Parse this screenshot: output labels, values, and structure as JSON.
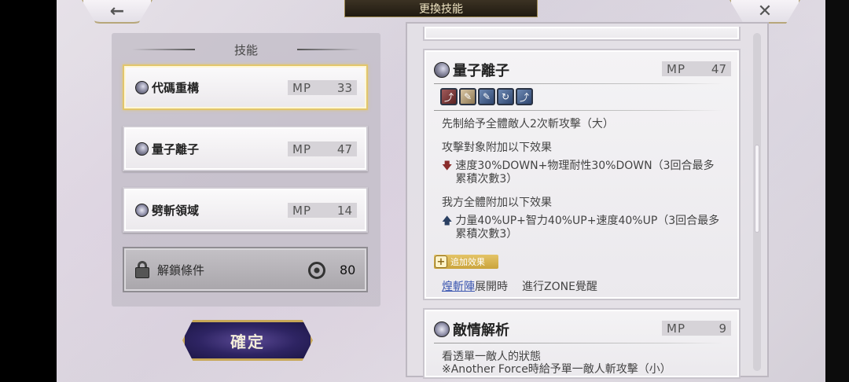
{
  "header": {
    "title": "更換技能",
    "back_icon": "←",
    "close_icon": "✕"
  },
  "left_panel": {
    "title": "技能",
    "skills": [
      {
        "name": "代碼重構",
        "mp_label": "MP",
        "mp": "33",
        "icon": "quantum-icon",
        "selected": true
      },
      {
        "name": "量子離子",
        "mp_label": "MP",
        "mp": "47",
        "icon": "quantum-icon",
        "selected": false
      },
      {
        "name": "劈斬領域",
        "mp_label": "MP",
        "mp": "14",
        "icon": "star-burst-icon",
        "selected": false
      }
    ],
    "unlock": {
      "label": "解鎖條件",
      "value": "80",
      "icon": "spiral-icon"
    }
  },
  "confirm_label": "確定",
  "detail": {
    "skill1": {
      "name": "量子離子",
      "mp_label": "MP",
      "mp": "47",
      "description": "先制給予全體敵人2次斬攻擊（大）",
      "enemy_header": "攻擊對象附加以下效果",
      "enemy_effect": "速度30%DOWN+物理耐性30%DOWN（3回合最多累積次數3）",
      "ally_header": "我方全體附加以下效果",
      "ally_effect": "力量40%UP+智力40%UP+速度40%UP（3回合最多累積次數3）",
      "bonus_tag": "追加效果",
      "bonus_link": "煌斬陣",
      "bonus_link_suffix": "展開時",
      "bonus_desc": "進行ZONE覺醒"
    },
    "skill2": {
      "name": "敵情解析",
      "mp_label": "MP",
      "mp": "9",
      "description": "看透單一敵人的狀態",
      "description2": "※Another Force時給予單一敵人斬攻擊（小）"
    }
  },
  "colors": {
    "accent_gold": "#c7a757",
    "confirm_purple": "#2e2463",
    "link_blue": "#3b56b0"
  }
}
